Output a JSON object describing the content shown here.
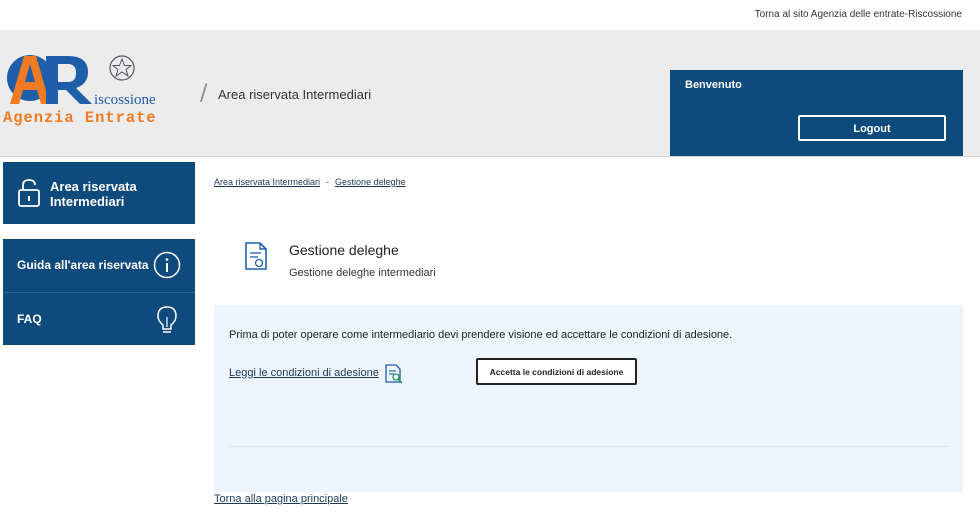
{
  "topbar": {
    "link": "Torna al sito Agenzia delle entrate-Riscossione"
  },
  "header": {
    "logo_line1": "iscossione",
    "logo_line2": "Agenzia Entrate",
    "logo_mark": "AeR",
    "area_title": "Area riservata Intermediari"
  },
  "welcome": {
    "greeting": "Benvenuto",
    "logout": "Logout"
  },
  "sidebar": {
    "main": "Area riservata Intermediari",
    "items": [
      {
        "label": "Guida all'area riservata",
        "icon": "info-icon"
      },
      {
        "label": "FAQ",
        "icon": "lightbulb-icon"
      }
    ]
  },
  "breadcrumb": {
    "items": [
      "Area riservata Intermediari",
      "Gestione deleghe"
    ],
    "separator": "-"
  },
  "page": {
    "title": "Gestione deleghe",
    "subtitle": "Gestione deleghe intermediari"
  },
  "panel": {
    "message": "Prima di poter operare come intermediario devi prendere visione ed accettare le condizioni di adesione.",
    "read_link": "Leggi le condizioni di adesione",
    "accept_button": "Accetta le condizioni di adesione"
  },
  "footer_link": "Torna alla pagina principale",
  "colors": {
    "brand_blue": "#0f4a7d",
    "panel_bg": "#edf4fb",
    "header_bg": "#ececec",
    "logo_orange": "#f07b22",
    "logo_blue": "#1f5ea8"
  }
}
